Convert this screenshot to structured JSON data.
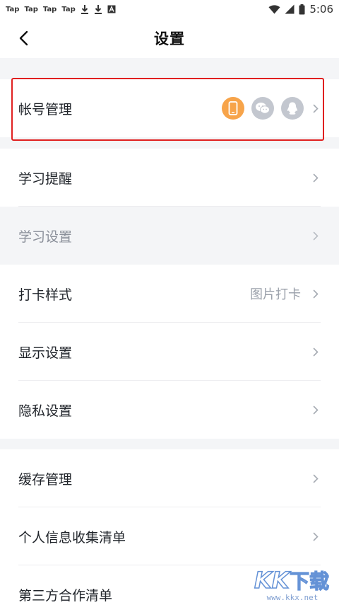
{
  "status_bar": {
    "notifications": [
      "Tap",
      "Tap",
      "Tap",
      "Tap"
    ],
    "time": "5:06"
  },
  "header": {
    "title": "设置",
    "back_icon": "chevron-left-icon"
  },
  "sections": [
    {
      "items": [
        {
          "label": "帐号管理",
          "login_methods": [
            {
              "icon": "phone-icon",
              "color": "#f7a44a"
            },
            {
              "icon": "wechat-icon",
              "color": "#c3c7cf"
            },
            {
              "icon": "qq-icon",
              "color": "#c3c7cf"
            }
          ]
        }
      ]
    },
    {
      "items": [
        {
          "label": "学习提醒"
        },
        {
          "label": "学习设置",
          "disabled": true
        },
        {
          "label": "打卡样式",
          "value": "图片打卡"
        },
        {
          "label": "显示设置"
        },
        {
          "label": "隐私设置"
        }
      ]
    },
    {
      "items": [
        {
          "label": "缓存管理"
        },
        {
          "label": "个人信息收集清单"
        },
        {
          "label": "第三方合作清单"
        }
      ]
    }
  ],
  "colors": {
    "accent": "#f7a44a",
    "highlight_border": "#e02020",
    "secondary_text": "#9aa0aa"
  },
  "watermark": {
    "logo": "KK下载",
    "url": "www.kkx.net"
  }
}
